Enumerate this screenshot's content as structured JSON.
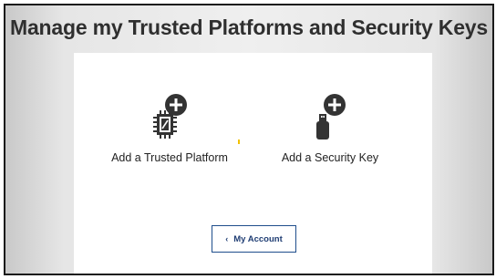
{
  "page": {
    "title": "Manage my Trusted Platforms and Security Keys"
  },
  "options": [
    {
      "label": "Add a Trusted Platform",
      "icon": "chip-plus-icon"
    },
    {
      "label": "Add a Security Key",
      "icon": "usb-key-plus-icon"
    }
  ],
  "footer": {
    "account_button_label": "My Account",
    "account_button_icon": "chevron-left-icon"
  },
  "colors": {
    "title_text": "#2f2f2f",
    "icon_fill": "#333333",
    "button_border": "#1f4e8c",
    "button_text": "#1f3d73",
    "accent": "#f2c200"
  }
}
